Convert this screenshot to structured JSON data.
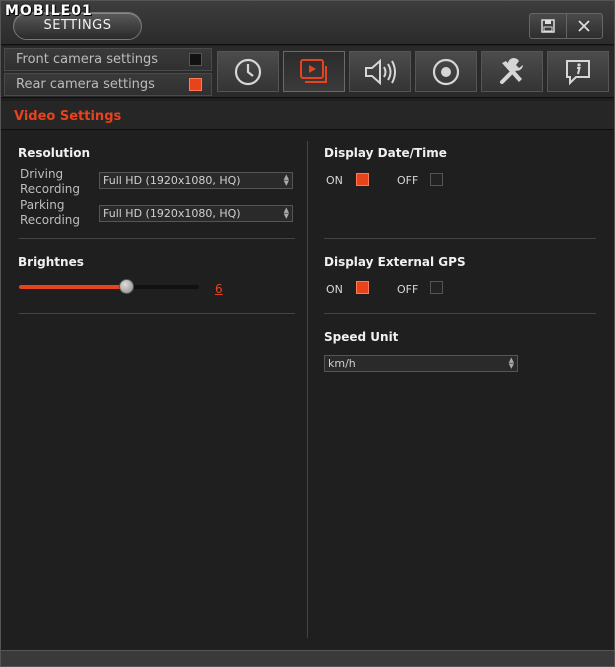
{
  "titlebar": {
    "logo": "MOBILE01",
    "settings_label": "SETTINGS",
    "buttons": [
      {
        "name": "save",
        "icon": "save-icon"
      },
      {
        "name": "close",
        "icon": "close-icon"
      }
    ]
  },
  "camera": {
    "front_label": "Front camera settings",
    "rear_label": "Rear camera settings",
    "selected": "rear"
  },
  "tabs": [
    {
      "icon": "clock-icon",
      "active": false
    },
    {
      "icon": "video-icon",
      "active": true
    },
    {
      "icon": "speaker-icon",
      "active": false
    },
    {
      "icon": "record-icon",
      "active": false
    },
    {
      "icon": "tools-icon",
      "active": false
    },
    {
      "icon": "info-icon",
      "active": false
    }
  ],
  "section": {
    "title": "Video Settings"
  },
  "resolution": {
    "heading": "Resolution",
    "driving_label_1": "Driving",
    "driving_label_2": "Recording",
    "driving_value": "Full HD (1920x1080, HQ)",
    "parking_label_1": "Parking",
    "parking_label_2": "Recording",
    "parking_value": "Full HD (1920x1080, HQ)"
  },
  "brightness": {
    "heading": "Brightnes",
    "value": "6",
    "level_fraction": 0.6
  },
  "date_time": {
    "heading": "Display Date/Time",
    "on_label": "ON",
    "off_label": "OFF",
    "state": "on"
  },
  "gps": {
    "heading": "Display External GPS",
    "on_label": "ON",
    "off_label": "OFF",
    "state": "on"
  },
  "speed": {
    "heading": "Speed Unit",
    "value": "km/h"
  },
  "colors": {
    "accent": "#e8431c",
    "background": "#1f1f1f"
  }
}
